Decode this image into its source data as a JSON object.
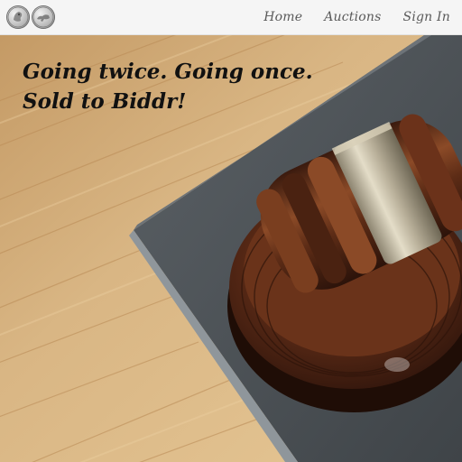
{
  "header": {
    "logo_icon": "coins-logo-icon",
    "nav": [
      {
        "label": "Home"
      },
      {
        "label": "Auctions"
      },
      {
        "label": "Sign In"
      }
    ]
  },
  "hero": {
    "tagline_line1": "Going twice. Going once.",
    "tagline_line2": "Sold to Biddr!",
    "image_subject": "auction-gavel-image",
    "colors": {
      "wood": "#d7b27e",
      "book": "#4e5357",
      "gavel": "#5a2a16",
      "band": "#b9b09a",
      "text": "#111111"
    }
  }
}
